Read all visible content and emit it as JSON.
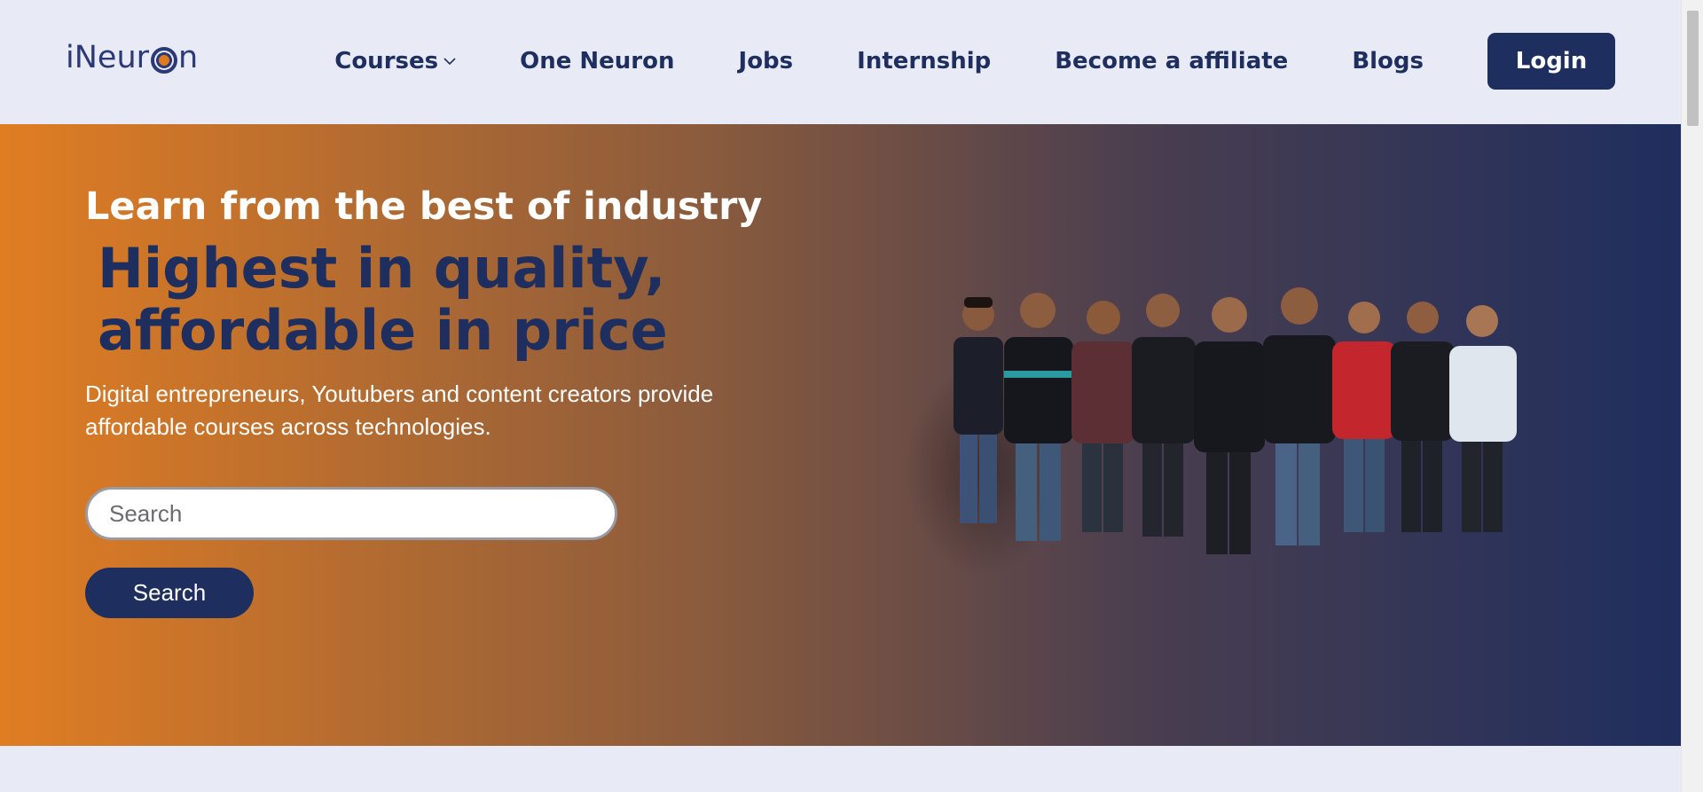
{
  "header": {
    "logo": {
      "text_left": "iNeur",
      "text_right": "n",
      "brand_colors": {
        "navy": "#2b3a77",
        "orange": "#e07a1f"
      }
    },
    "nav": [
      {
        "label": "Courses",
        "has_dropdown": true,
        "icon": "chevron-down-icon"
      },
      {
        "label": "One Neuron"
      },
      {
        "label": "Jobs"
      },
      {
        "label": "Internship"
      },
      {
        "label": "Become a affiliate"
      },
      {
        "label": "Blogs"
      }
    ],
    "login_label": "Login"
  },
  "hero": {
    "kicker": "Learn from the best of industry",
    "headline_line1": "Highest in quality,",
    "headline_line2": "affordable in price",
    "description": "Digital entrepreneurs, Youtubers and content creators provide affordable courses across technologies.",
    "search": {
      "placeholder": "Search",
      "value": ""
    },
    "search_button_label": "Search",
    "gradient": {
      "start": "#e07d23",
      "mid": "#8a5b3d",
      "end": "#1f2e5e"
    },
    "team_photo": {
      "people_count": 9,
      "alt": "team-photo"
    }
  },
  "colors": {
    "navy": "#1e2e5e",
    "page_bg": "#e8ebf5",
    "white": "#ffffff"
  }
}
